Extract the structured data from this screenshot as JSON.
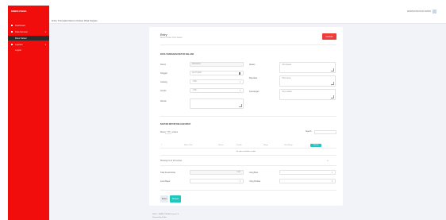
{
  "app": {
    "brand": "SIMRS PEDIA"
  },
  "sidebar": {
    "items": [
      {
        "label": "Dashboard",
        "arrow": ""
      },
      {
        "label": "Data Farmasi",
        "arrow": "▾"
      },
      {
        "label": "Retur Keluar",
        "arrow": ""
      },
      {
        "label": "Laporan",
        "arrow": "▾"
      },
      {
        "label": "Logout",
        "arrow": ""
      }
    ]
  },
  "header": {
    "page_title": "Entry Transaksi Return Keluar Obat Satuan",
    "user": "ADMINISTRATOR ADMIN"
  },
  "card": {
    "title": "Entry",
    "subtitle": "Return Keluar Obat Satuan",
    "back_button": "Kembali"
  },
  "section1": {
    "title": "DATA TRANSAKSI RETUR KELUAR"
  },
  "form": {
    "nomor": {
      "label": "Nomor",
      "value": "RK001001"
    },
    "tanggal": {
      "label": "Tanggal",
      "value": "02-07-2020"
    },
    "gudang": {
      "label": "Gudang",
      "value": "- Pilih -"
    },
    "vendor": {
      "label": "Vendor",
      "value": "- Pilih -"
    },
    "alamat": {
      "label": "Alamat",
      "value": ""
    },
    "alasan": {
      "label": "Alasan",
      "placeholder": "Tulis alasan"
    },
    "diperiksa": {
      "label": "Diperiksa",
      "placeholder": "Tulis nama"
    },
    "keterangan": {
      "label": "Keterangan",
      "placeholder": "Tulis catatan"
    }
  },
  "section2": {
    "title": "DAFTAR RETUR KELUAR OBAT",
    "show_label": "Show",
    "show_value": "10",
    "entries_label": "entries",
    "search_label": "Search:",
    "columns": [
      "#",
      "Nama Obat",
      "Satuan",
      "Jumlah",
      "Harga",
      "Total Harga"
    ],
    "add_button": "Tambah",
    "empty_text": "No data available in table",
    "summary_label": "Showing 0 to 0 of 0 entries"
  },
  "summary": {
    "total_label": "Total Keseluruhan",
    "total_value": "0,00",
    "yang_buat_label": "Yang Buat",
    "jenis_bayar_label": "Jenis Bayar",
    "yang_periksa_label": "Yang Periksa"
  },
  "actions": {
    "reset": "Reset",
    "simpan": "Simpan"
  },
  "footer": {
    "line1": "2020 © SIMRS PEDIA Version 1.0",
    "line2": "Powered by Pedia"
  }
}
